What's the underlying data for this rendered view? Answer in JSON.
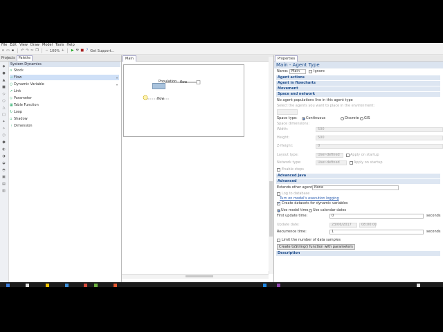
{
  "menu": [
    "File",
    "Edit",
    "View",
    "Draw",
    "Model",
    "Tools",
    "Help"
  ],
  "toolbar": {
    "zoom": "100%",
    "get_support": "Get Support..."
  },
  "left_tabs": [
    "Projects",
    "Palette"
  ],
  "palette": {
    "header": "System Dynamics",
    "items": [
      {
        "label": "Stock",
        "icon": "▫"
      },
      {
        "label": "Flow",
        "icon": "→"
      },
      {
        "label": "Dynamic Variable",
        "icon": "○"
      },
      {
        "label": "Link",
        "icon": "↗"
      },
      {
        "label": "Parameter",
        "icon": "◇"
      },
      {
        "label": "Table Function",
        "icon": "▦"
      },
      {
        "label": "Loop",
        "icon": "↻"
      },
      {
        "label": "Shadow",
        "icon": "▫"
      },
      {
        "label": "Dimension",
        "icon": "⋮"
      }
    ]
  },
  "editor": {
    "tab": "Main",
    "stock_label": "Population",
    "flow_label_1": "flow",
    "flow_label_2": "flow"
  },
  "properties": {
    "tab": "Properties",
    "title": "Main - Agent Type",
    "name_label": "Name:",
    "name_value": "Main",
    "ignore_label": "Ignore",
    "sections": {
      "agent_actions": "Agent actions",
      "agent_flowcharts": "Agent in flowcharts",
      "movement": "Movement",
      "space_network": "Space and network",
      "advanced_java": "Advanced Java",
      "advanced": "Advanced",
      "description": "Description"
    },
    "no_populations": "No agent populations live in this agent type",
    "select_agents": "Select the agents you want to place in the environment:",
    "space_type_label": "Space type:",
    "space_types": [
      "Continuous",
      "Discrete",
      "GIS"
    ],
    "space_dimensions": "Space dimensions:",
    "width_label": "Width:",
    "width_value": "500",
    "height_label": "Height:",
    "height_value": "500",
    "zheight_label": "Z-Height:",
    "zheight_value": "0",
    "layout_type_label": "Layout type:",
    "layout_type_value": "User-defined",
    "apply_on_startup_1": "Apply on startup",
    "network_type_label": "Network type:",
    "network_type_value": "User-defined",
    "apply_on_startup_2": "Apply on startup",
    "enable_steps": "Enable steps",
    "extends_label": "Extends other agent:",
    "extends_value": "None",
    "log_to_db": "Log to database",
    "turn_on_log": "Turn on model's execution logging",
    "create_datasets": "Create datasets for dynamic variables",
    "use_model_time": "Use model time",
    "use_calendar": "Use calendar dates",
    "first_update_label": "First update time:",
    "first_update_value": "0",
    "seconds_1": "seconds",
    "update_date_label": "Update date:",
    "update_date_value": "23/06/2017",
    "update_time_value": "08:00:00",
    "recurrence_label": "Recurrence time:",
    "recurrence_value": "1",
    "seconds_2": "seconds",
    "limit_samples": "Limit the number of data samples",
    "tostring_button": "Create toString() function with parameters"
  },
  "colors": {
    "accent": "#1f4e8c",
    "section_bg": "#dde6f2",
    "stock_fill": "#a9c3dd"
  }
}
